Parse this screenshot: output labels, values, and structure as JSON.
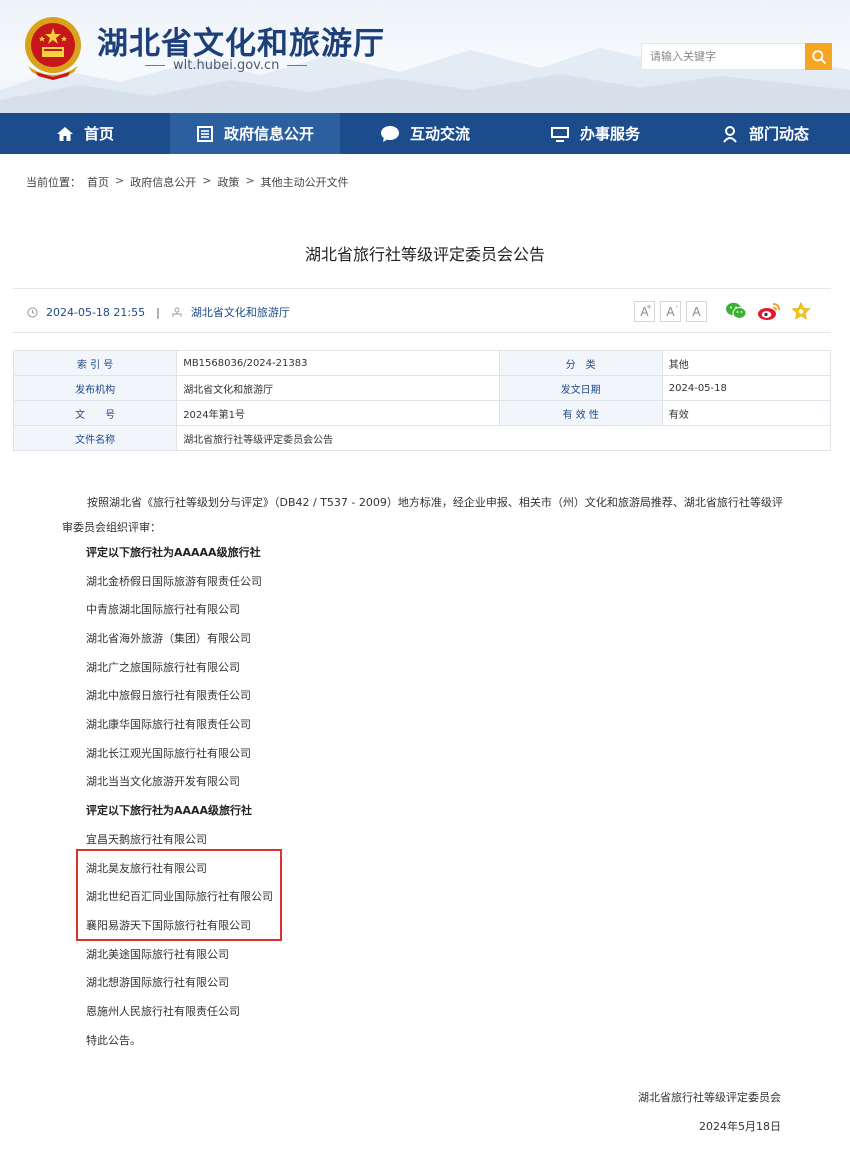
{
  "header": {
    "site_title": "湖北省文化和旅游厅",
    "site_domain": "wlt.hubei.gov.cn",
    "search_placeholder": "请输入关键字",
    "search_icon": "search-icon",
    "accent_color": "#1c4c8c"
  },
  "nav": {
    "items": [
      {
        "label": "首页",
        "icon": "home-icon"
      },
      {
        "label": "政府信息公开",
        "icon": "document-icon"
      },
      {
        "label": "互动交流",
        "icon": "chat-icon"
      },
      {
        "label": "办事服务",
        "icon": "monitor-icon"
      },
      {
        "label": "部门动态",
        "icon": "person-icon"
      }
    ],
    "active_index": 1
  },
  "breadcrumb": {
    "prefix": "当前位置：",
    "items": [
      "首页",
      "政府信息公开",
      "政策",
      "其他主动公开文件"
    ],
    "separator": ">"
  },
  "article": {
    "title": "湖北省旅行社等级评定委员会公告",
    "datetime": "2024-05-18 21:55",
    "source": "湖北省文化和旅游厅",
    "font_buttons": [
      "A",
      "A",
      "A"
    ],
    "font_sup": [
      "+",
      "-"
    ]
  },
  "info": {
    "index_label": "索 引 号",
    "index_value": "MB1568036/2024-21383",
    "category_label": "分　类",
    "category_value": "其他",
    "issuer_label": "发布机构",
    "issuer_value": "湖北省文化和旅游厅",
    "date_label": "发文日期",
    "date_value": "2024-05-18",
    "docno_label": "文　　号",
    "docno_value": "2024年第1号",
    "validity_label": "有 效 性",
    "validity_value": "有效",
    "filename_label": "文件名称",
    "filename_value": "湖北省旅行社等级评定委员会公告"
  },
  "body": {
    "intro": "按照湖北省《旅行社等级划分与评定》（DB42 / T537 - 2009）地方标准，经企业申报、相关市（州）文化和旅游局推荐、湖北省旅行社等级评审委员会组织评审：",
    "heading_5a": "评定以下旅行社为AAAAA级旅行社",
    "list_5a": [
      "湖北金桥假日国际旅游有限责任公司",
      "中青旅湖北国际旅行社有限公司",
      "湖北省海外旅游（集团）有限公司",
      "湖北广之旅国际旅行社有限公司",
      "湖北中旅假日旅行社有限责任公司",
      "湖北康华国际旅行社有限责任公司",
      "湖北长江观光国际旅行社有限公司",
      "湖北当当文化旅游开发有限公司"
    ],
    "heading_4a": "评定以下旅行社为AAAA级旅行社",
    "list_4a": [
      "宜昌天鹅旅行社有限公司",
      "湖北昊友旅行社有限公司",
      "湖北世纪百汇同业国际旅行社有限公司",
      "襄阳易游天下国际旅行社有限公司",
      "湖北美途国际旅行社有限公司",
      "湖北想游国际旅行社有限公司",
      "恩施州人民旅行社有限责任公司"
    ],
    "closing": "特此公告。",
    "signature_org": "湖北省旅行社等级评定委员会",
    "signature_date": "2024年5月18日",
    "highlight_color": "#e0322a"
  }
}
